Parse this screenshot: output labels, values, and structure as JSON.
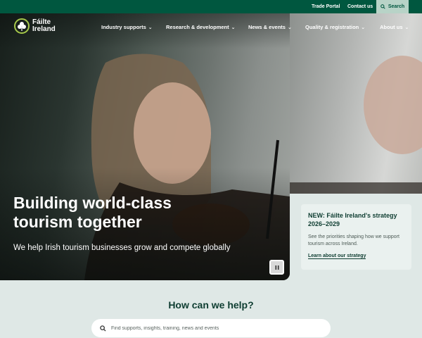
{
  "utility": {
    "trade_portal": "Trade Portal",
    "contact_us": "Contact us",
    "search": "Search"
  },
  "logo": {
    "line1": "Fáilte",
    "line2": "Ireland"
  },
  "nav": {
    "items": [
      {
        "label": "Industry supports"
      },
      {
        "label": "Research & development"
      },
      {
        "label": "News & events"
      },
      {
        "label": "Quality & registration"
      },
      {
        "label": "About us"
      }
    ]
  },
  "hero": {
    "title": "Building world-class tourism together",
    "subtitle": "We help Irish tourism businesses grow and compete globally"
  },
  "promo": {
    "title": "NEW: Fáilte Ireland's strategy 2026–2029",
    "description": "See the priorities shaping how we support tourism across Ireland.",
    "link": "Learn about our strategy"
  },
  "help": {
    "heading": "How can we help?",
    "search_placeholder": "Find supports, insights, training, news and events"
  },
  "colors": {
    "brand_green": "#00573f",
    "search_bg": "#b8d3c7",
    "page_bg": "#dfe8e6"
  }
}
